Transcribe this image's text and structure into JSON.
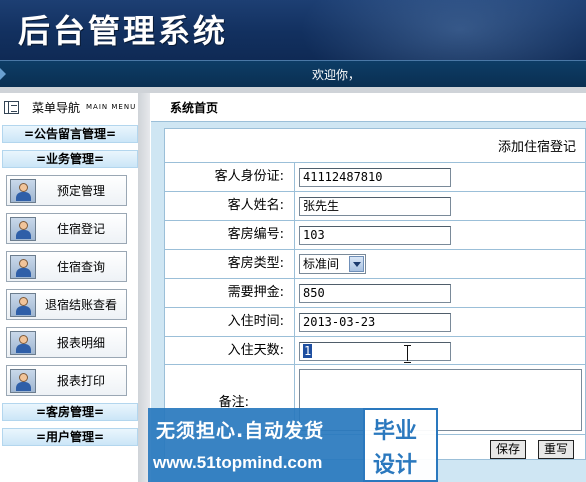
{
  "app": {
    "title": "后台管理系统",
    "welcome": "欢迎你，"
  },
  "sidebar": {
    "header_cn": "菜单导航",
    "header_en": "MAIN MENU",
    "groups": {
      "notice": "=公告留言管理=",
      "business": "=业务管理=",
      "room": "=客房管理=",
      "user": "=用户管理="
    },
    "items": [
      {
        "label": "预定管理"
      },
      {
        "label": "住宿登记"
      },
      {
        "label": "住宿查询"
      },
      {
        "label": "退宿结账查看"
      },
      {
        "label": "报表明细"
      },
      {
        "label": "报表打印"
      }
    ]
  },
  "main": {
    "breadcrumb": "系统首页",
    "form_title": "添加住宿登记",
    "fields": {
      "id_card": {
        "label": "客人身份证:",
        "value": "41112487810"
      },
      "name": {
        "label": "客人姓名:",
        "value": "张先生"
      },
      "room_no": {
        "label": "客房编号:",
        "value": "103"
      },
      "room_type": {
        "label": "客房类型:",
        "value": "标准间"
      },
      "deposit": {
        "label": "需要押金:",
        "value": "850"
      },
      "checkin": {
        "label": "入住时间:",
        "value": "2013-03-23"
      },
      "days": {
        "label": "入住天数:",
        "value": "1"
      },
      "notes": {
        "label": "备注:",
        "value": ""
      }
    },
    "buttons": {
      "save": "保存",
      "reset": "重写"
    }
  },
  "watermark": {
    "line1": "无须担心.自动发货",
    "line2": "www.51topmind.com",
    "right1": "毕业",
    "right2": "设计"
  }
}
